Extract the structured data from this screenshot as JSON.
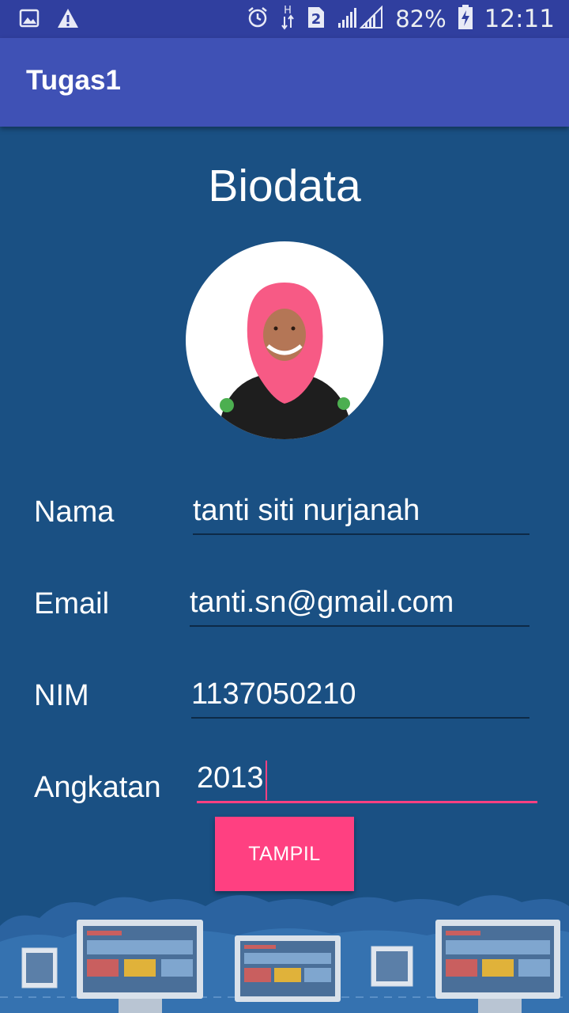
{
  "status_bar": {
    "battery": "82%",
    "time": "12:11",
    "network": "H",
    "sim": "2",
    "icons": [
      "image-notification-icon",
      "warning-icon",
      "alarm-icon",
      "data-arrows-icon",
      "sim-icon",
      "signal-icon",
      "battery-charging-icon"
    ]
  },
  "app_bar": {
    "title": "Tugas1"
  },
  "page": {
    "title": "Biodata"
  },
  "form": {
    "nama": {
      "label": "Nama",
      "value": "tanti siti nurjanah"
    },
    "email": {
      "label": "Email",
      "value": "tanti.sn@gmail.com"
    },
    "nim": {
      "label": "NIM",
      "value": "1137050210"
    },
    "angkatan": {
      "label": "Angkatan",
      "value": "2013"
    }
  },
  "button": {
    "label": "TAMPIL"
  },
  "colors": {
    "primary_dark": "#303f9f",
    "primary": "#3f51b5",
    "accent": "#ff4081",
    "background": "#1a5083"
  }
}
